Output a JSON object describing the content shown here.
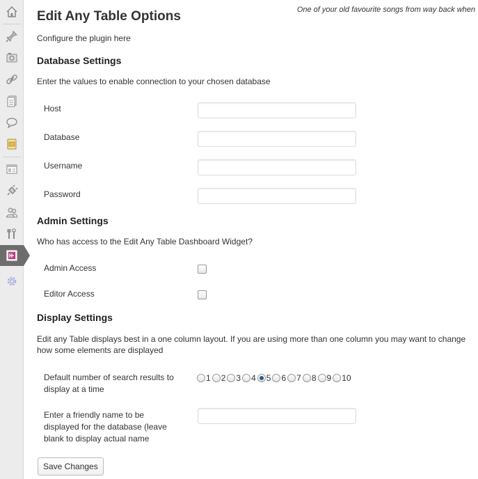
{
  "sidebar": {
    "icons": [
      "dashboard-icon",
      "posts-icon",
      "media-icon",
      "links-icon",
      "pages-icon",
      "comments-icon",
      "feedback-icon",
      "appearance-icon",
      "plugins-icon",
      "users-icon",
      "tools-icon",
      "edit-any-table-icon",
      "settings-icon"
    ]
  },
  "header": {
    "lyrics": "One of your old favourite songs from way back when"
  },
  "page": {
    "title": "Edit Any Table Options",
    "intro": "Configure the plugin here"
  },
  "database": {
    "heading": "Database Settings",
    "description": "Enter the values to enable connection to your chosen database",
    "host_label": "Host",
    "host_value": "",
    "database_label": "Database",
    "database_value": "",
    "username_label": "Username",
    "username_value": "",
    "password_label": "Password",
    "password_value": ""
  },
  "admin": {
    "heading": "Admin Settings",
    "description": "Who has access to the Edit Any Table Dashboard Widget?",
    "admin_access_label": "Admin Access",
    "admin_access_checked": false,
    "editor_access_label": "Editor Access",
    "editor_access_checked": false
  },
  "display": {
    "heading": "Display Settings",
    "description": "Edit any Table displays best in a one column layout. If you are using more than one column you may want to change how some elements are displayed",
    "results_label": "Default number of search results to display at a time",
    "results_options": [
      "1",
      "2",
      "3",
      "4",
      "5",
      "6",
      "7",
      "8",
      "9",
      "10"
    ],
    "results_selected": "5",
    "friendly_name_label": "Enter a friendly name to be displayed for the database (leave blank to display actual name",
    "friendly_name_value": ""
  },
  "actions": {
    "save_label": "Save Changes"
  }
}
